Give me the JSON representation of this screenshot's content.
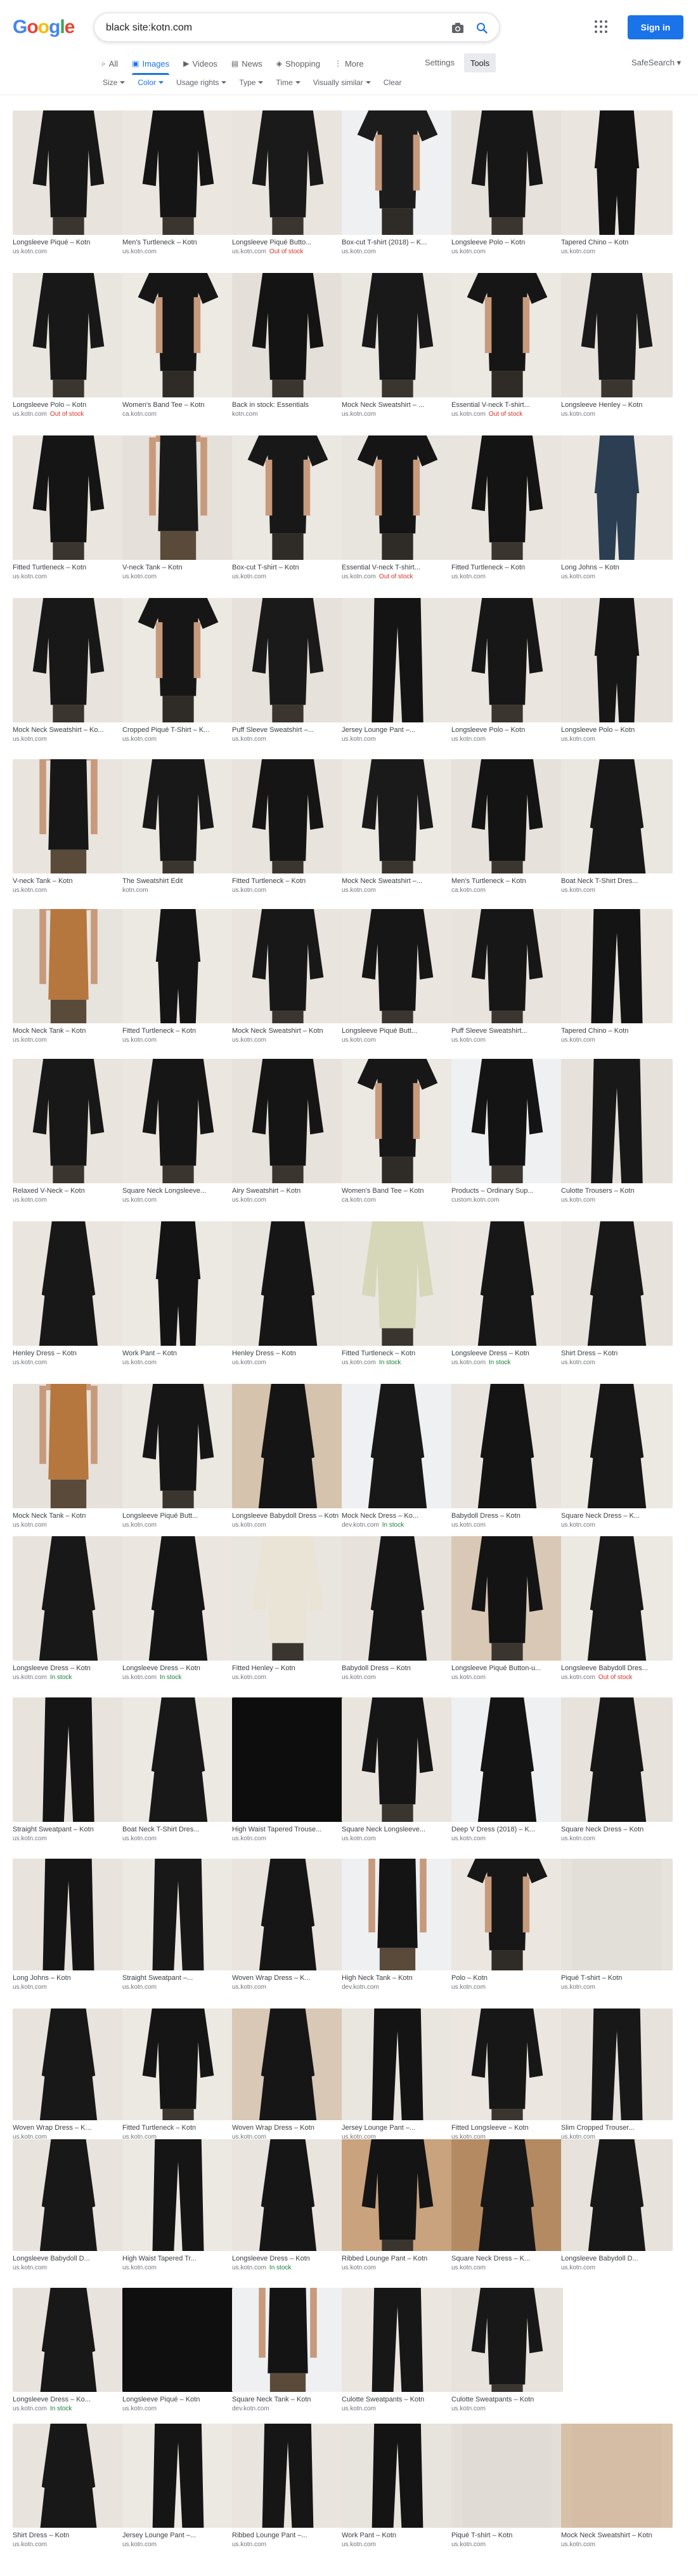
{
  "search": {
    "query": "black site:kotn.com"
  },
  "header": {
    "logo": "Google",
    "signin_label": "Sign in",
    "settings_label": "Settings",
    "tools_label": "Tools",
    "safesearch_label": "SafeSearch"
  },
  "tabs": [
    {
      "label": "All",
      "icon": "search-icon"
    },
    {
      "label": "Images",
      "icon": "image-icon"
    },
    {
      "label": "Videos",
      "icon": "video-icon"
    },
    {
      "label": "News",
      "icon": "news-icon"
    },
    {
      "label": "Shopping",
      "icon": "tag-icon"
    },
    {
      "label": "More",
      "icon": "more-vert-icon"
    }
  ],
  "filters": [
    "Size",
    "Color",
    "Usage rights",
    "Type",
    "Time",
    "Visually similar",
    "Clear"
  ],
  "colors": {
    "accent": "#1a73e8",
    "out_of_stock": "#d93025",
    "in_stock": "#188038",
    "bg_light": "#ece8e3",
    "product_black": "#181818"
  },
  "rows": [
    [
      {
        "title": "Longsleeve Piqué – Kotn",
        "source": "us.kotn.com",
        "bg": "#e8e3dc",
        "kind": "shirt",
        "gar": "#181818"
      },
      {
        "title": "Men's Turtleneck – Kotn",
        "source": "us.kotn.com",
        "bg": "#ebe6df",
        "kind": "shirt",
        "gar": "#151515"
      },
      {
        "title": "Longsleeve Piqué Butto...",
        "source": "us.kotn.com",
        "status": "Out of stock",
        "bg": "#e9e4dd",
        "kind": "shirt",
        "gar": "#1a1a1a"
      },
      {
        "title": "Box-cut T-shirt (2018) – K...",
        "source": "us.kotn.com",
        "bg": "#eef0f2",
        "kind": "tee",
        "gar": "#1c1c1c"
      },
      {
        "title": "Longsleeve Polo – Kotn",
        "source": "us.kotn.com",
        "bg": "#e6e1da",
        "kind": "shirt",
        "gar": "#171717"
      },
      {
        "title": "Tapered Chino – Kotn",
        "source": "us.kotn.com",
        "bg": "#eae5de",
        "kind": "full",
        "gar": "#141414"
      }
    ],
    [
      {
        "title": "Longsleeve Polo – Kotn",
        "source": "us.kotn.com",
        "status": "Out of stock",
        "bg": "#e9e5df",
        "kind": "shirt",
        "gar": "#181818"
      },
      {
        "title": "Women's Band Tee – Kotn",
        "source": "ca.kotn.com",
        "bg": "#ede9e3",
        "kind": "tee",
        "gar": "#161616"
      },
      {
        "title": "Back in stock: Essentials",
        "source": "kotn.com",
        "bg": "#e4dfd8",
        "kind": "shirt",
        "gar": "#141414"
      },
      {
        "title": "Mock Neck Sweatshirt – ...",
        "source": "us.kotn.com",
        "bg": "#eae6e0",
        "kind": "shirt",
        "gar": "#191919"
      },
      {
        "title": "Essential V-neck T-shirt...",
        "source": "us.kotn.com",
        "status": "Out of stock",
        "bg": "#ece8e2",
        "kind": "tee",
        "gar": "#161616"
      },
      {
        "title": "Longsleeve Henley – Kotn",
        "source": "us.kotn.com",
        "bg": "#e7e2db",
        "kind": "shirt",
        "gar": "#1a1a1a"
      }
    ],
    [
      {
        "title": "Fitted Turtleneck – Kotn",
        "source": "us.kotn.com",
        "bg": "#eae5de",
        "kind": "shirt",
        "gar": "#151515"
      },
      {
        "title": "V-neck Tank – Kotn",
        "source": "us.kotn.com",
        "bg": "#e5e0d9",
        "kind": "tank",
        "gar": "#1a1a1a"
      },
      {
        "title": "Box-cut T-shirt – Kotn",
        "source": "us.kotn.com",
        "bg": "#ebe7e1",
        "kind": "tee",
        "gar": "#181818"
      },
      {
        "title": "Essential V-neck T-shirt...",
        "source": "us.kotn.com",
        "status": "Out of stock",
        "bg": "#e8e4de",
        "kind": "tee",
        "gar": "#151515"
      },
      {
        "title": "Fitted Turtleneck – Kotn",
        "source": "us.kotn.com",
        "bg": "#e9e4dd",
        "kind": "shirt",
        "gar": "#141414"
      },
      {
        "title": "Long Johns – Kotn",
        "source": "us.kotn.com",
        "bg": "#ebe7e0",
        "kind": "full",
        "gar": "#2c3e52"
      }
    ],
    [
      {
        "title": "Mock Neck Sweatshirt – Ko...",
        "source": "us.kotn.com",
        "bg": "#e8e3dc",
        "kind": "shirt",
        "gar": "#181818"
      },
      {
        "title": "Cropped Piqué T-Shirt – K...",
        "source": "us.kotn.com",
        "bg": "#ece8e2",
        "kind": "tee",
        "gar": "#161616"
      },
      {
        "title": "Puff Sleeve Sweatshirt –...",
        "source": "us.kotn.com",
        "bg": "#e6e1da",
        "kind": "shirt",
        "gar": "#1a1a1a"
      },
      {
        "title": "Jersey Lounge Pant –...",
        "source": "us.kotn.com",
        "bg": "#e9e5df",
        "kind": "pant",
        "gar": "#141414"
      },
      {
        "title": "Longsleeve Polo – Kotn",
        "source": "us.kotn.com",
        "bg": "#eae6df",
        "kind": "shirt",
        "gar": "#171717"
      },
      {
        "title": "Longsleeve Polo – Kotn",
        "source": "us.kotn.com",
        "bg": "#e7e2dc",
        "kind": "full",
        "gar": "#161616"
      }
    ],
    [
      {
        "title": "V-neck Tank – Kotn",
        "source": "us.kotn.com",
        "bg": "#e9e4dd",
        "kind": "tank",
        "gar": "#171717"
      },
      {
        "title": "The Sweatshirt Edit",
        "source": "kotn.com",
        "bg": "#ebe7e1",
        "kind": "shirt",
        "gar": "#181818"
      },
      {
        "title": "Fitted Turtleneck – Kotn",
        "source": "us.kotn.com",
        "bg": "#e8e3dc",
        "kind": "shirt",
        "gar": "#151515"
      },
      {
        "title": "Mock Neck Sweatshirt –...",
        "source": "us.kotn.com",
        "bg": "#ece8e2",
        "kind": "shirt",
        "gar": "#1a1a1a"
      },
      {
        "title": "Men's Turtleneck – Kotn",
        "source": "ca.kotn.com",
        "bg": "#e6e1da",
        "kind": "shirt",
        "gar": "#141414"
      },
      {
        "title": "Boat Neck T-Shirt Dres...",
        "source": "us.kotn.com",
        "bg": "#eae6e0",
        "kind": "dress",
        "gar": "#181818"
      }
    ],
    [
      {
        "title": "Mock Neck Tank – Kotn",
        "source": "us.kotn.com",
        "bg": "#e7e3dd",
        "kind": "tank",
        "gar": "#b5773e"
      },
      {
        "title": "Fitted Turtleneck – Kotn",
        "source": "us.kotn.com",
        "bg": "#ece8e2",
        "kind": "full",
        "gar": "#151515"
      },
      {
        "title": "Mock Neck Sweatshirt – Kotn",
        "source": "us.kotn.com",
        "bg": "#e9e4dd",
        "kind": "shirt",
        "gar": "#181818"
      },
      {
        "title": "Longsleeve Piqué Butt...",
        "source": "us.kotn.com",
        "bg": "#eae5de",
        "kind": "shirt",
        "gar": "#161616"
      },
      {
        "title": "Puff Sleeve Sweatshirt...",
        "source": "us.kotn.com",
        "bg": "#e8e4dd",
        "kind": "shirt",
        "gar": "#171717"
      },
      {
        "title": "Tapered Chino – Kotn",
        "source": "us.kotn.com",
        "bg": "#ebe7e0",
        "kind": "pant",
        "gar": "#141414"
      }
    ],
    [
      {
        "title": "Relaxed V-Neck – Kotn",
        "source": "us.kotn.com",
        "bg": "#e9e4dd",
        "kind": "shirt",
        "gar": "#181818"
      },
      {
        "title": "Square Neck Longsleeve...",
        "source": "us.kotn.com",
        "bg": "#ebe6df",
        "kind": "shirt",
        "gar": "#161616"
      },
      {
        "title": "Airy Sweatshirt – Kotn",
        "source": "us.kotn.com",
        "bg": "#e7e2db",
        "kind": "shirt",
        "gar": "#151515"
      },
      {
        "title": "Women's Band Tee – Kotn",
        "source": "ca.kotn.com",
        "bg": "#ece8e2",
        "kind": "tee",
        "gar": "#171717"
      },
      {
        "title": "Products – Ordinary Sup...",
        "source": "custom.kotn.com",
        "bg": "#eef0f2",
        "kind": "shirt",
        "gar": "#141414"
      },
      {
        "title": "Culotte Trousers – Kotn",
        "source": "us.kotn.com",
        "bg": "#e6e1da",
        "kind": "pant",
        "gar": "#181818"
      }
    ],
    [
      {
        "title": "Henley Dress – Kotn",
        "source": "us.kotn.com",
        "bg": "#eae5de",
        "kind": "dress",
        "gar": "#181818"
      },
      {
        "title": "Work Pant – Kotn",
        "source": "us.kotn.com",
        "bg": "#ece8e2",
        "kind": "full",
        "gar": "#141414"
      },
      {
        "title": "Henley Dress – Kotn",
        "source": "us.kotn.com",
        "bg": "#e8e4de",
        "kind": "dress",
        "gar": "#161616"
      },
      {
        "title": "Fitted Turtleneck – Kotn",
        "source": "us.kotn.com",
        "status": "In stock",
        "bg": "#e9e5df",
        "kind": "shirt",
        "gar": "#d6d6b8"
      },
      {
        "title": "Longsleeve Dress – Kotn",
        "source": "us.kotn.com",
        "status": "In stock",
        "bg": "#ebe7e0",
        "kind": "dress",
        "gar": "#171717"
      },
      {
        "title": "Shirt Dress – Kotn",
        "source": "us.kotn.com",
        "bg": "#e7e2db",
        "kind": "dress",
        "gar": "#181818"
      }
    ],
    [
      {
        "title": "Mock Neck Tank – Kotn",
        "source": "us.kotn.com",
        "bg": "#e6e1da",
        "kind": "tank",
        "gar": "#b5773e"
      },
      {
        "title": "Longsleeve Piqué Butt...",
        "source": "us.kotn.com",
        "bg": "#ebe7e1",
        "kind": "shirt",
        "gar": "#161616"
      },
      {
        "title": "Longsleeve Babydoll Dress – Kotn",
        "source": "us.kotn.com",
        "bg": "#d6c3ae",
        "kind": "dress",
        "gar": "#151515"
      },
      {
        "title": "Mock Neck Dress – Ko...",
        "source": "dev.kotn.com",
        "status": "In stock",
        "bg": "#eef0f2",
        "kind": "dress",
        "gar": "#181818"
      },
      {
        "title": "Babydoll Dress – Kotn",
        "source": "us.kotn.com",
        "bg": "#e9e4dd",
        "kind": "dress",
        "gar": "#141414"
      },
      {
        "title": "Square Neck Dress – K...",
        "source": "us.kotn.com",
        "bg": "#ece8e2",
        "kind": "dress",
        "gar": "#171717"
      }
    ],
    [
      {
        "title": "Longsleeve Dress – Kotn",
        "source": "us.kotn.com",
        "status": "In stock",
        "bg": "#e8e3dc",
        "kind": "dress",
        "gar": "#181818"
      },
      {
        "title": "Longsleeve Dress – Kotn",
        "source": "us.kotn.com",
        "status": "In stock",
        "bg": "#ebe7e0",
        "kind": "dress",
        "gar": "#151515"
      },
      {
        "title": "Fitted Henley – Kotn",
        "source": "us.kotn.com",
        "bg": "#e9e5df",
        "kind": "shirt",
        "gar": "#eae4d6"
      },
      {
        "title": "Babydoll Dress – Kotn",
        "source": "us.kotn.com",
        "bg": "#e7e2db",
        "kind": "dress",
        "gar": "#161616"
      },
      {
        "title": "Longsleeve Piqué Button-u...",
        "source": "us.kotn.com",
        "bg": "#d9c8b5",
        "kind": "shirt",
        "gar": "#141414"
      },
      {
        "title": "Longsleeve Babydoll Dres...",
        "source": "us.kotn.com",
        "status": "Out of stock",
        "bg": "#ece8e2",
        "kind": "dress",
        "gar": "#181818"
      }
    ],
    [
      {
        "title": "Straight Sweatpant – Kotn",
        "source": "us.kotn.com",
        "bg": "#e8e3dc",
        "kind": "pant",
        "gar": "#151515"
      },
      {
        "title": "Boat Neck T-Shirt Dres...",
        "source": "us.kotn.com",
        "bg": "#ece8e2",
        "kind": "dress",
        "gar": "#181818"
      },
      {
        "title": "High Waist Tapered Trouse...",
        "source": "us.kotn.com",
        "bg": "#121212",
        "kind": "dark",
        "gar": "#0d0d0d"
      },
      {
        "title": "Square Neck Longsleeve...",
        "source": "us.kotn.com",
        "bg": "#e9e4dd",
        "kind": "shirt",
        "gar": "#161616"
      },
      {
        "title": "Deep V Dress (2018) – K...",
        "source": "us.kotn.com",
        "bg": "#eef0f2",
        "kind": "dress",
        "gar": "#141414"
      },
      {
        "title": "Square Neck Dress – Kotn",
        "source": "us.kotn.com",
        "bg": "#e7e2db",
        "kind": "dress",
        "gar": "#171717"
      }
    ],
    [
      {
        "title": "Long Johns – Kotn",
        "source": "us.kotn.com",
        "bg": "#e8e3dc",
        "kind": "pant",
        "gar": "#151515"
      },
      {
        "title": "Straight Sweatpant –...",
        "source": "us.kotn.com",
        "bg": "#ece8e2",
        "kind": "pant",
        "gar": "#181818"
      },
      {
        "title": "Woven Wrap Dress – K...",
        "source": "us.kotn.com",
        "bg": "#e9e4dd",
        "kind": "dress",
        "gar": "#161616"
      },
      {
        "title": "High Neck Tank – Kotn",
        "source": "dev.kotn.com",
        "bg": "#eef0f2",
        "kind": "tank",
        "gar": "#141414"
      },
      {
        "title": "Polo – Kotn",
        "source": "us.kotn.com",
        "bg": "#ebe7e0",
        "kind": "tee",
        "gar": "#171717"
      },
      {
        "title": "Piqué T-shirt – Kotn",
        "source": "us.kotn.com",
        "bg": "#e6e2dc",
        "kind": "blank",
        "gar": "#d8d4cc"
      }
    ],
    [
      {
        "title": "Woven Wrap Dress – K...",
        "source": "us.kotn.com",
        "bg": "#e8e3dc",
        "kind": "dress",
        "gar": "#181818"
      },
      {
        "title": "Fitted Turtleneck – Kotn",
        "source": "us.kotn.com",
        "bg": "#ece8e2",
        "kind": "shirt",
        "gar": "#151515"
      },
      {
        "title": "Woven Wrap Dress – Kotn",
        "source": "us.kotn.com",
        "bg": "#d9c8b5",
        "kind": "dress",
        "gar": "#161616"
      },
      {
        "title": "Jersey Lounge Pant –...",
        "source": "us.kotn.com",
        "bg": "#e9e5df",
        "kind": "pant",
        "gar": "#141414"
      },
      {
        "title": "Fitted Longsleeve – Kotn",
        "source": "us.kotn.com",
        "bg": "#ebe7e0",
        "kind": "shirt",
        "gar": "#171717"
      },
      {
        "title": "Slim Cropped Trouser...",
        "source": "us.kotn.com",
        "bg": "#e7e2db",
        "kind": "pant",
        "gar": "#181818"
      }
    ],
    [
      {
        "title": "Longsleeve Babydoll D...",
        "source": "us.kotn.com",
        "bg": "#e8e3dc",
        "kind": "dress",
        "gar": "#181818"
      },
      {
        "title": "High Waist Tapered Tr...",
        "source": "us.kotn.com",
        "bg": "#ece8e2",
        "kind": "pant",
        "gar": "#151515"
      },
      {
        "title": "Longsleeve Dress – Kotn",
        "source": "us.kotn.com",
        "status": "In stock",
        "bg": "#e9e4dd",
        "kind": "dress",
        "gar": "#161616"
      },
      {
        "title": "Ribbed Lounge Pant – Kotn",
        "source": "us.kotn.com",
        "bg": "#c9a37e",
        "kind": "shirt",
        "gar": "#141414"
      },
      {
        "title": "Square Neck Dress – K...",
        "source": "us.kotn.com",
        "bg": "#b48a62",
        "kind": "dress",
        "gar": "#171717"
      },
      {
        "title": "Longsleeve Babydoll D...",
        "source": "us.kotn.com",
        "bg": "#e7e2db",
        "kind": "dress",
        "gar": "#181818"
      }
    ],
    [
      {
        "title": "Longsleeve Dress – Ko...",
        "source": "us.kotn.com",
        "status": "In stock",
        "bg": "#e8e3dc",
        "kind": "dress",
        "gar": "#181818"
      },
      {
        "title": "Longsleeve Piqué – Kotn",
        "source": "us.kotn.com",
        "bg": "#1a1a1a",
        "kind": "dark",
        "gar": "#0f0f0f"
      },
      {
        "title": "Square Neck Tank – Kotn",
        "source": "dev.kotn.com",
        "bg": "#eef0f2",
        "kind": "tank",
        "gar": "#141414"
      },
      {
        "title": "Culotte Sweatpants – Kotn",
        "source": "us.kotn.com",
        "bg": "#ebe7e0",
        "kind": "pant",
        "gar": "#171717"
      },
      {
        "title": "Culotte Sweatpants – Kotn",
        "source": "us.kotn.com",
        "bg": "#e7e2db",
        "kind": "shirt",
        "gar": "#181818"
      }
    ],
    [
      {
        "title": "Shirt Dress – Kotn",
        "source": "us.kotn.com",
        "bg": "#e8e3dc",
        "kind": "dress",
        "gar": "#181818"
      },
      {
        "title": "Jersey Lounge Pant –...",
        "source": "us.kotn.com",
        "bg": "#ece8e2",
        "kind": "pant",
        "gar": "#151515"
      },
      {
        "title": "Ribbed Lounge Pant –...",
        "source": "us.kotn.com",
        "bg": "#e9e4dd",
        "kind": "pant",
        "gar": "#161616"
      },
      {
        "title": "Work Pant – Kotn",
        "source": "us.kotn.com",
        "bg": "#e7e3dd",
        "kind": "pant",
        "gar": "#141414"
      },
      {
        "title": "Piqué T-shirt – Kotn",
        "source": "us.kotn.com",
        "bg": "#e3dfd8",
        "kind": "blank",
        "gar": "#d8d4cc"
      },
      {
        "title": "Mock Neck Sweatshirt – Kotn",
        "source": "us.kotn.com",
        "bg": "#d7c0a8",
        "kind": "blank",
        "gar": "#cbb296"
      }
    ]
  ]
}
